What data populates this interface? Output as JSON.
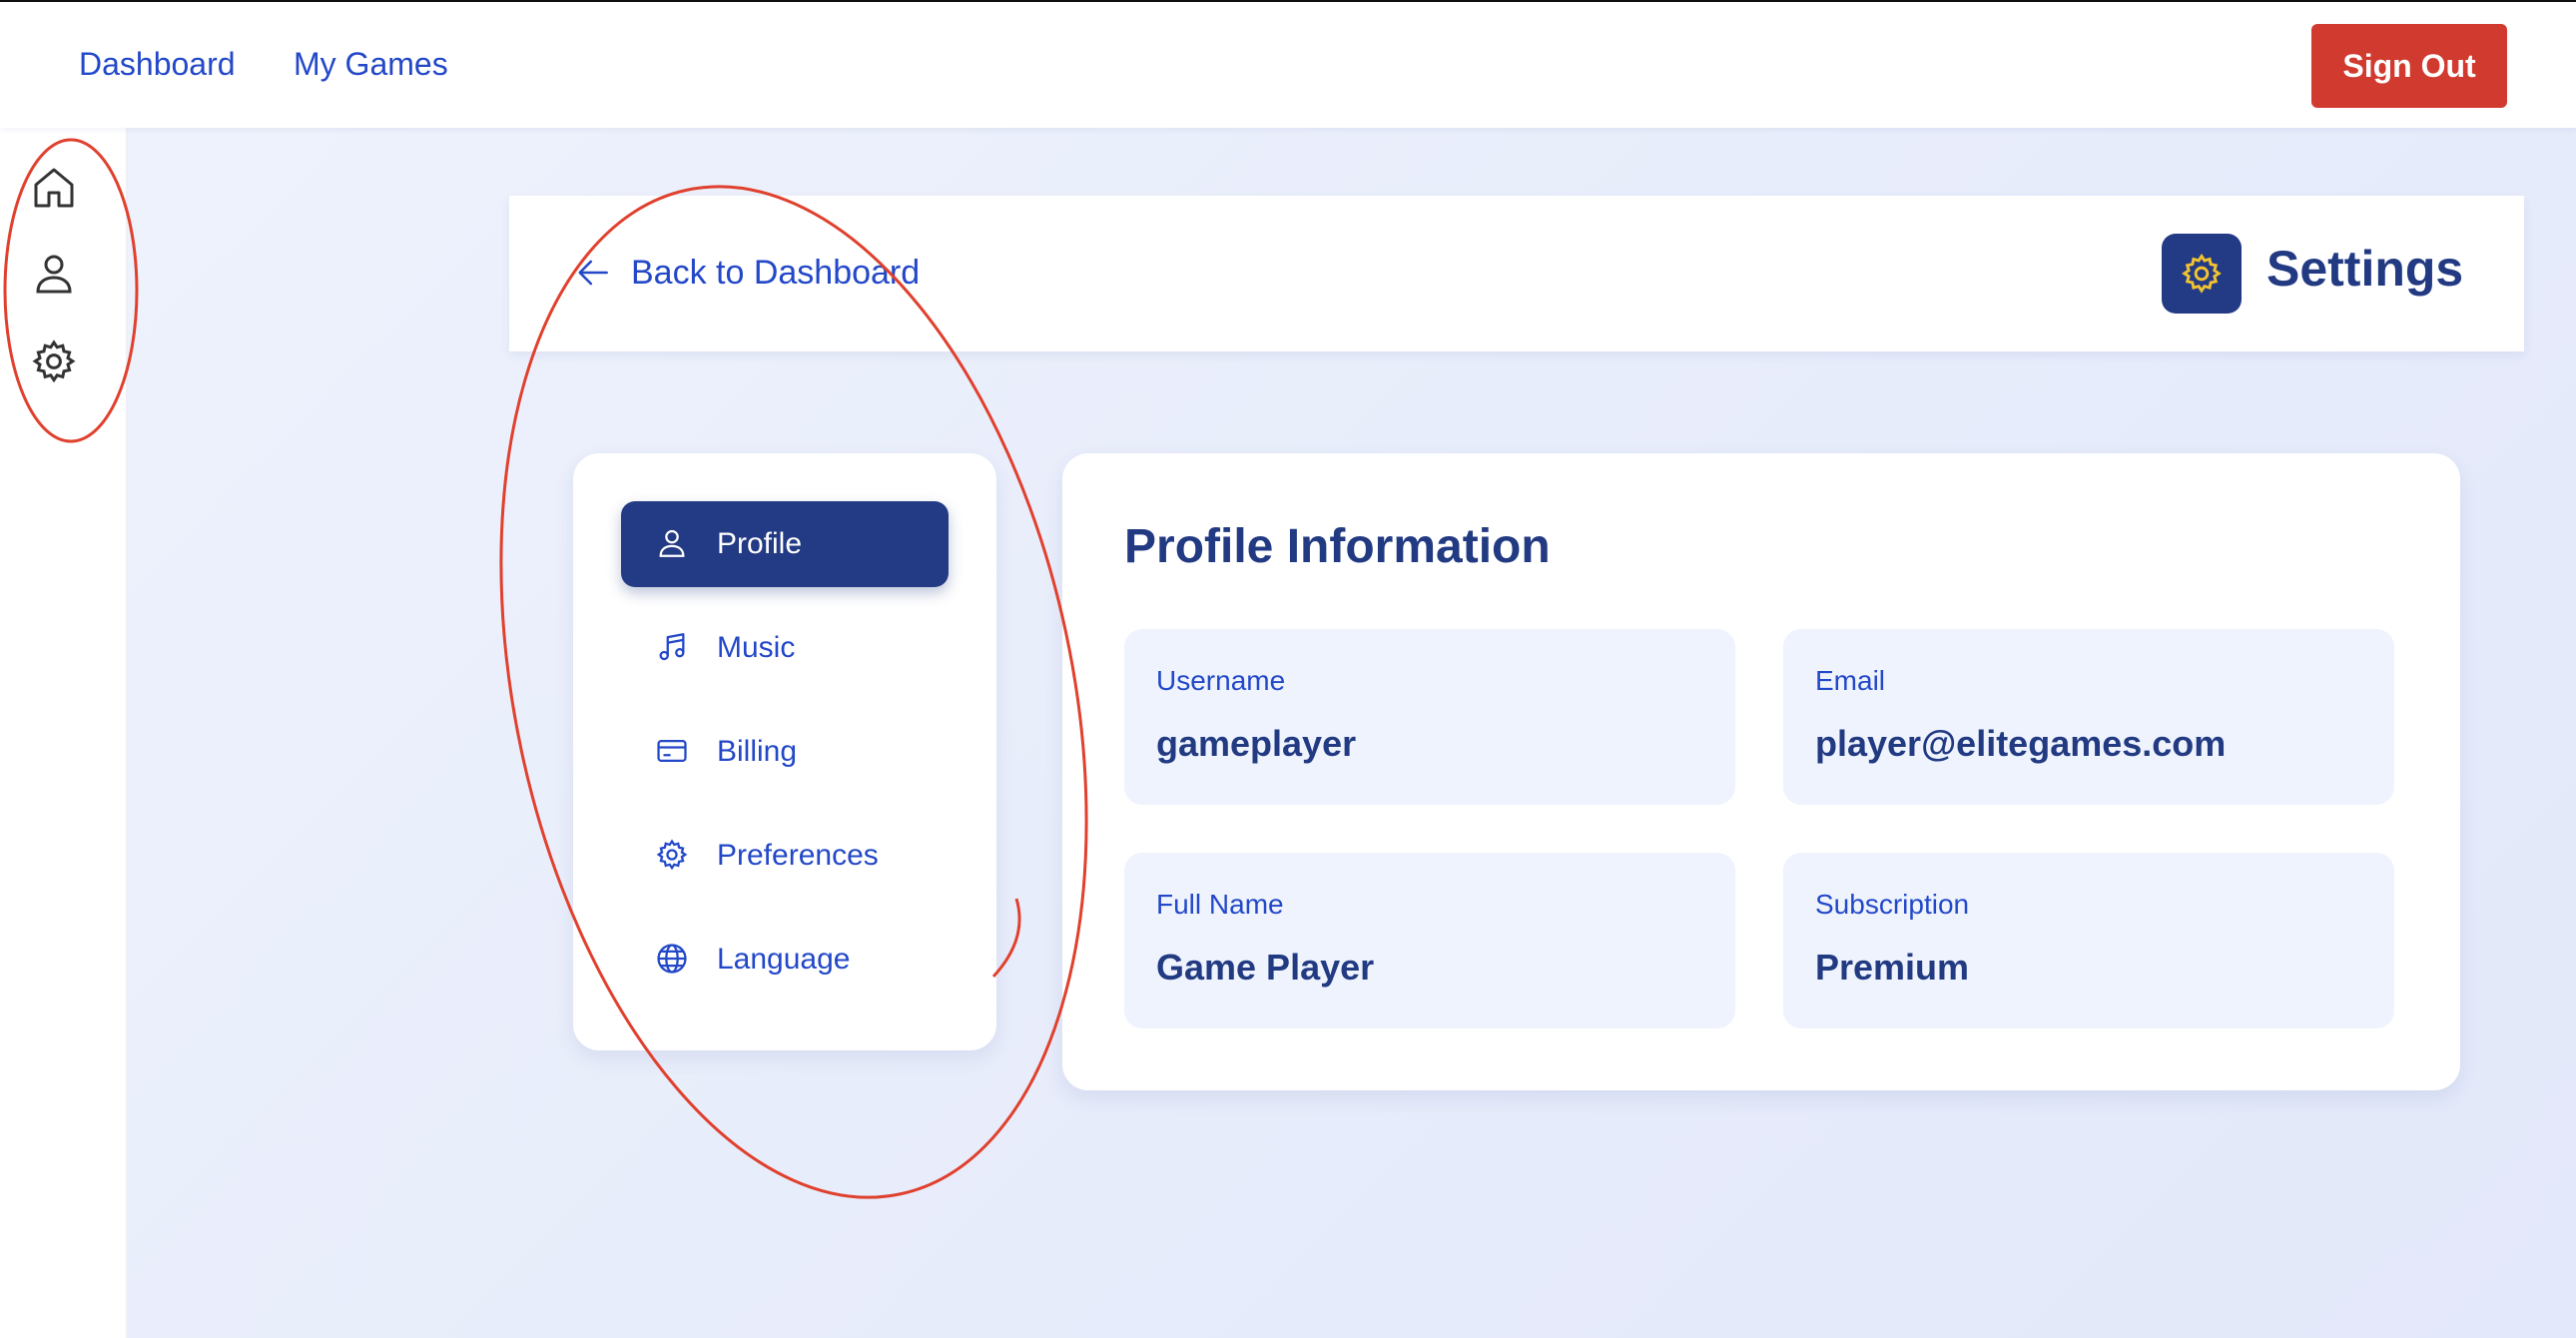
{
  "topbar": {
    "links": [
      "Dashboard",
      "My Games"
    ],
    "sign_out": "Sign Out"
  },
  "sidebar": {
    "icons": [
      "home-icon",
      "user-icon",
      "gear-icon"
    ]
  },
  "header": {
    "back_label": "Back to Dashboard",
    "title": "Settings"
  },
  "menu": {
    "items": [
      {
        "label": "Profile",
        "icon": "user-icon",
        "active": true
      },
      {
        "label": "Music",
        "icon": "music-note-icon",
        "active": false
      },
      {
        "label": "Billing",
        "icon": "credit-card-icon",
        "active": false
      },
      {
        "label": "Preferences",
        "icon": "gear-icon",
        "active": false
      },
      {
        "label": "Language",
        "icon": "globe-icon",
        "active": false
      }
    ]
  },
  "profile": {
    "title": "Profile Information",
    "fields": [
      {
        "label": "Username",
        "value": "gameplayer"
      },
      {
        "label": "Email",
        "value": "player@elitegames.com"
      },
      {
        "label": "Full Name",
        "value": "Game Player"
      },
      {
        "label": "Subscription",
        "value": "Premium"
      }
    ]
  },
  "colors": {
    "primary": "#233a85",
    "link": "#2348c8",
    "danger": "#d13a2f",
    "accent_gear": "#f2c230",
    "annotation": "#e0412e"
  }
}
